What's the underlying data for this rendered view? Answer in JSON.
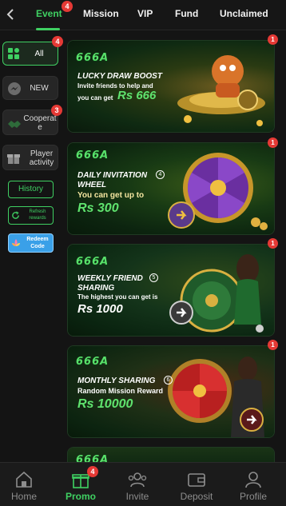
{
  "tabs": [
    {
      "label": "Event",
      "active": true,
      "badge": "4"
    },
    {
      "label": "Mission"
    },
    {
      "label": "VIP"
    },
    {
      "label": "Fund"
    },
    {
      "label": "Unclaimed"
    }
  ],
  "sidebar": {
    "all": {
      "label": "All",
      "badge": "4"
    },
    "new": {
      "label": "NEW"
    },
    "cooperate": {
      "label_line1": "Cooperat",
      "label_line2": "e",
      "badge": "3"
    },
    "player_activity": {
      "label_line1": "Player",
      "label_line2": "activity"
    },
    "history": {
      "label": "History"
    },
    "refresh": {
      "label_line1": "Refresh",
      "label_line2": "rewards"
    },
    "redeem": {
      "label_line1": "Redeem",
      "label_line2": "Code"
    }
  },
  "banners": [
    {
      "logo": "666A",
      "title": "LUCKY DRAW BOOST",
      "sub1": "Invite friends to help and",
      "sub2": "you can get",
      "amount": "Rs 666",
      "badge": "1"
    },
    {
      "logo": "666A",
      "title1": "DAILY INVITATION",
      "title2": "WHEEL",
      "sub1": "You can get up to",
      "amount": "Rs 300",
      "badge": "1",
      "marker": "4"
    },
    {
      "logo": "666A",
      "title1": "WEEKLY FRIEND",
      "title2": "SHARING",
      "sub1": "The highest you can get is",
      "amount": "Rs 1000",
      "badge": "1",
      "marker": "5"
    },
    {
      "logo": "666A",
      "title1": "MONTHLY SHARING",
      "sub1": "Random Mission Reward",
      "amount": "Rs 10000",
      "badge": "1",
      "marker": "6"
    },
    {
      "logo": "666A"
    }
  ],
  "bottom_nav": [
    {
      "label": "Home",
      "icon": "home-icon"
    },
    {
      "label": "Promo",
      "icon": "gift-icon",
      "active": true,
      "badge": "4"
    },
    {
      "label": "Invite",
      "icon": "users-icon"
    },
    {
      "label": "Deposit",
      "icon": "wallet-icon"
    },
    {
      "label": "Profile",
      "icon": "person-icon"
    }
  ],
  "colors": {
    "accent": "#3fd062",
    "badge": "#e53935",
    "background": "#141414"
  }
}
